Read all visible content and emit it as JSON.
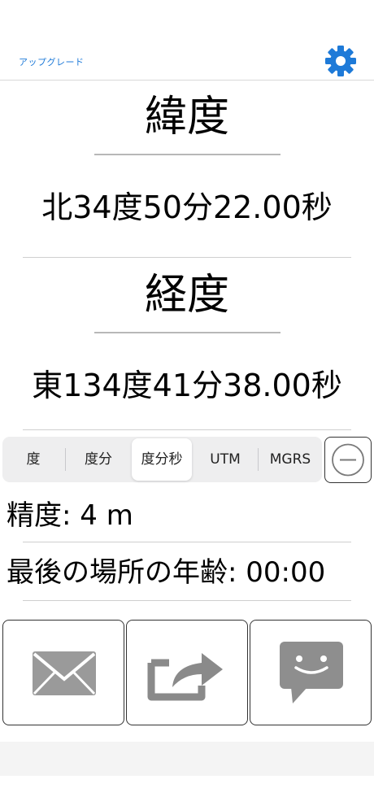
{
  "header": {
    "upgrade_label": "アップグレード",
    "settings_icon": "gear-icon"
  },
  "latitude": {
    "label": "緯度",
    "value": "北34度50分22.00秒"
  },
  "longitude": {
    "label": "経度",
    "value": "東134度41分38.00秒"
  },
  "format_segments": [
    {
      "label": "度",
      "selected": false
    },
    {
      "label": "度分",
      "selected": false
    },
    {
      "label": "度分秒",
      "selected": true
    },
    {
      "label": "UTM",
      "selected": false
    },
    {
      "label": "MGRS",
      "selected": false
    }
  ],
  "accuracy": {
    "text": "精度: 4 m"
  },
  "last_location_age": {
    "text": "最後の場所の年齢: 00:00"
  },
  "actions": [
    {
      "icon": "mail-icon"
    },
    {
      "icon": "share-icon"
    },
    {
      "icon": "message-icon"
    }
  ],
  "colors": {
    "accent": "#1e7ad8",
    "icon_gray": "#8e8e8e"
  }
}
